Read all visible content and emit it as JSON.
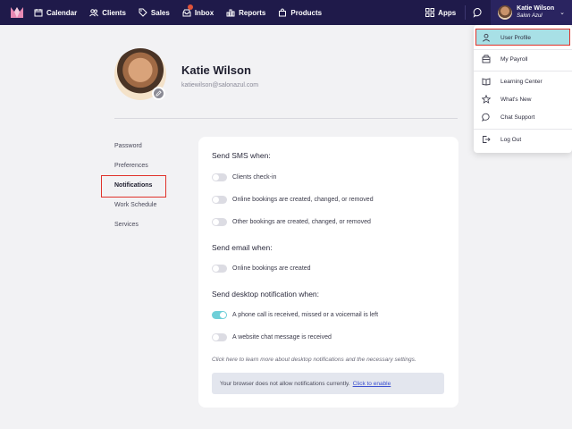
{
  "topnav": {
    "items": [
      {
        "label": "Calendar",
        "icon": "calendar-icon"
      },
      {
        "label": "Clients",
        "icon": "clients-icon"
      },
      {
        "label": "Sales",
        "icon": "tag-icon"
      },
      {
        "label": "Inbox",
        "icon": "inbox-icon"
      },
      {
        "label": "Reports",
        "icon": "bar-chart-icon"
      },
      {
        "label": "Products",
        "icon": "bag-icon"
      }
    ],
    "apps_label": "Apps",
    "user": {
      "name": "Katie Wilson",
      "salon": "Salon Azul"
    },
    "colors": {
      "background": "#1f1a4a",
      "badge": "#e0533a"
    }
  },
  "profile": {
    "name": "Katie Wilson",
    "email": "katiewilson@salonazul.com"
  },
  "side_menu": {
    "items": [
      "Password",
      "Preferences",
      "Notifications",
      "Work Schedule",
      "Services"
    ],
    "active": "Notifications"
  },
  "notifications": {
    "sms_title": "Send SMS when:",
    "sms_options": [
      {
        "label": "Clients check-in",
        "enabled": false
      },
      {
        "label": "Online bookings are created, changed, or removed",
        "enabled": false
      },
      {
        "label": "Other bookings are created, changed, or removed",
        "enabled": false
      }
    ],
    "email_title": "Send email when:",
    "email_options": [
      {
        "label": "Online bookings are created",
        "enabled": false
      }
    ],
    "desktop_title": "Send desktop notification when:",
    "desktop_options": [
      {
        "label": "A phone call is received, missed or a voicemail is left",
        "enabled": true
      },
      {
        "label": "A website chat message is received",
        "enabled": false
      }
    ],
    "help_text": "Click here to learn more about desktop notifications and the necessary settings.",
    "notice_text": "Your browser does not allow notifications currently.",
    "notice_link": "Click to enable",
    "toggle_on_color": "#6fcfd8"
  },
  "dropdown": {
    "items": [
      {
        "label": "User Profile",
        "icon": "user-icon"
      },
      {
        "label": "My Payroll",
        "icon": "wallet-icon"
      },
      {
        "label": "Learning Center",
        "icon": "book-icon"
      },
      {
        "label": "What's New",
        "icon": "star-icon"
      },
      {
        "label": "Chat Support",
        "icon": "chat-bubble-icon"
      },
      {
        "label": "Log Out",
        "icon": "logout-icon"
      }
    ],
    "active": "User Profile",
    "active_color": "#a8e0e6"
  }
}
